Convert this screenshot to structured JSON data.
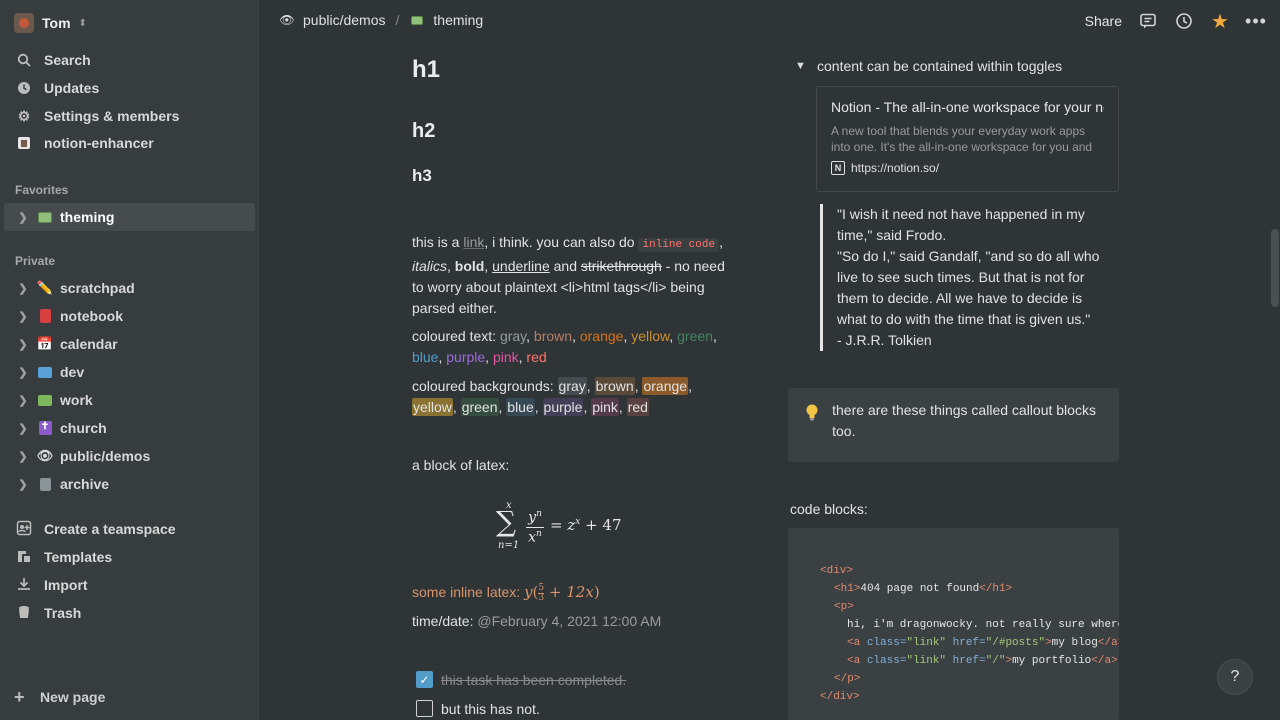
{
  "workspace": {
    "name": "Tom"
  },
  "nav": [
    {
      "label": "Search",
      "icon": "search-icon"
    },
    {
      "label": "Updates",
      "icon": "clock-icon"
    },
    {
      "label": "Settings & members",
      "icon": "gear-icon"
    },
    {
      "label": "notion-enhancer",
      "icon": "enhancer-icon"
    }
  ],
  "favorites": {
    "label": "Favorites",
    "items": [
      {
        "label": "theming",
        "icon": "theming-icon"
      }
    ]
  },
  "private": {
    "label": "Private",
    "items": [
      {
        "label": "scratchpad",
        "icon": "pencil-icon"
      },
      {
        "label": "notebook",
        "icon": "book-icon"
      },
      {
        "label": "calendar",
        "icon": "calendar-icon"
      },
      {
        "label": "dev",
        "icon": "laptop-icon"
      },
      {
        "label": "work",
        "icon": "money-icon"
      },
      {
        "label": "church",
        "icon": "cross-icon"
      },
      {
        "label": "public/demos",
        "icon": "eye-icon"
      },
      {
        "label": "archive",
        "icon": "wastebasket-icon"
      }
    ]
  },
  "bottom": [
    {
      "label": "Create a teamspace",
      "icon": "teamspace-icon"
    },
    {
      "label": "Templates",
      "icon": "templates-icon"
    },
    {
      "label": "Import",
      "icon": "import-icon"
    },
    {
      "label": "Trash",
      "icon": "trash-icon"
    }
  ],
  "new_page": "New page",
  "breadcrumb": {
    "parent": "public/demos",
    "separator": "/",
    "current": "theming"
  },
  "topbar": {
    "share": "Share"
  },
  "content": {
    "h1": "h1",
    "h2": "h2",
    "h3": "h3",
    "p1": {
      "a": "this is a ",
      "link": "link",
      "b": ", i think. you can also do ",
      "code": "inline code",
      "c": ",",
      "italics": "italics",
      "d": ", ",
      "bold": "bold",
      "e": ", ",
      "underline": "underline",
      "f": " and ",
      "strike": "strikethrough",
      "g": " - no need to worry about plaintext <li>html tags</li> being parsed either."
    },
    "coloured_text": {
      "label": "coloured text: ",
      "items": [
        "gray",
        "brown",
        "orange",
        "yellow",
        "green",
        "blue",
        "purple",
        "pink",
        "red"
      ]
    },
    "coloured_bg": {
      "label": "coloured backgrounds: ",
      "items": [
        "gray",
        "brown",
        "orange",
        "yellow",
        "green",
        "blue",
        "purple",
        "pink",
        "red"
      ]
    },
    "latex_label": "a block of latex:",
    "latex_block": {
      "sum_top": "x",
      "sum_bottom": "n=1",
      "frac_num": "y",
      "frac_num_exp": "n",
      "frac_den": "x",
      "frac_den_exp": "n",
      "rhs": "= z",
      "rhs_exp": "x",
      "rhs_tail": " + 47"
    },
    "inline_latex_label": "some inline latex: ",
    "inline_latex": {
      "y": "y",
      "num": "5",
      "den": "3",
      "tail": "+ 12x"
    },
    "timedate_label": "time/date: ",
    "timedate_value": "@February 4, 2021 12:00 AM",
    "tasks": [
      {
        "label": "this task has been completed.",
        "checked": true
      },
      {
        "label": "but this has not.",
        "checked": false
      }
    ]
  },
  "right": {
    "toggle": "content can be contained within toggles",
    "bookmark": {
      "title": "Notion - The all-in-one workspace for your notes, tasks, wikis, and databases.",
      "description": "A new tool that blends your everyday work apps into one. It's the all-in-one workspace for you and your team",
      "url": "https://notion.so/"
    },
    "quote": [
      "\"I wish it need not have happened in my time,\" said Frodo.",
      "\"So do I,\" said Gandalf, \"and so do all who live to see such times. But that is not for them to decide. All we have to decide is what to do with the time that is given us.\"",
      "- J.R.R. Tolkien"
    ],
    "callout": "there are these things called callout blocks too.",
    "code_label": "code blocks:",
    "code": {
      "l1_open": "<div>",
      "l2_open": "<h1>",
      "l2_text": "404 page not found",
      "l2_close": "</h1>",
      "l3": "<p>",
      "l4": "hi, i'm dragonwocky. not really sure where you were trying to go",
      "l5_tag": "<a ",
      "l5_attr1": "class=",
      "l5_val1": "\"link\"",
      "l5_attr2": " href=",
      "l5_val2": "\"/#posts\"",
      "l5_gt": ">",
      "l5_text": "my blog",
      "l5_close": "</a>",
      "l6_val2": "\"/\"",
      "l6_text": "my portfolio",
      "l7": "</p>",
      "l8": "</div>"
    }
  },
  "help": "?"
}
